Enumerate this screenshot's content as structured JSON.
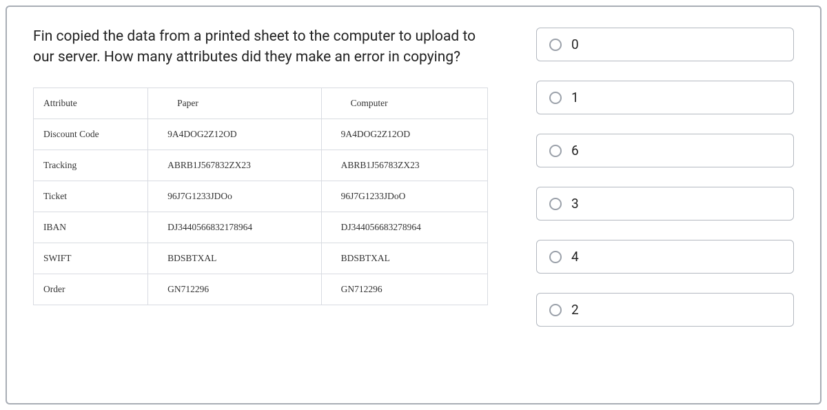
{
  "question": "Fin copied the data from a printed sheet to the computer to upload to our server. How many attributes did they make an error in copying?",
  "table": {
    "headers": [
      "Attribute",
      "Paper",
      "Computer"
    ],
    "rows": [
      {
        "attribute": "Discount Code",
        "paper": "9A4DOG2Z12OD",
        "computer": "9A4DOG2Z12OD"
      },
      {
        "attribute": "Tracking",
        "paper": "ABRB1J567832ZX23",
        "computer": "ABRB1J56783ZX23"
      },
      {
        "attribute": "Ticket",
        "paper": "96J7G1233JDOo",
        "computer": "96J7G1233JDoO"
      },
      {
        "attribute": "IBAN",
        "paper": "DJ3440566832178964",
        "computer": "DJ344056683278964"
      },
      {
        "attribute": "SWIFT",
        "paper": "BDSBTXAL",
        "computer": "BDSBTXAL"
      },
      {
        "attribute": "Order",
        "paper": "GN712296",
        "computer": "GN712296"
      }
    ]
  },
  "options": [
    {
      "label": "0"
    },
    {
      "label": "1"
    },
    {
      "label": "6"
    },
    {
      "label": "3"
    },
    {
      "label": "4"
    },
    {
      "label": "2"
    }
  ]
}
